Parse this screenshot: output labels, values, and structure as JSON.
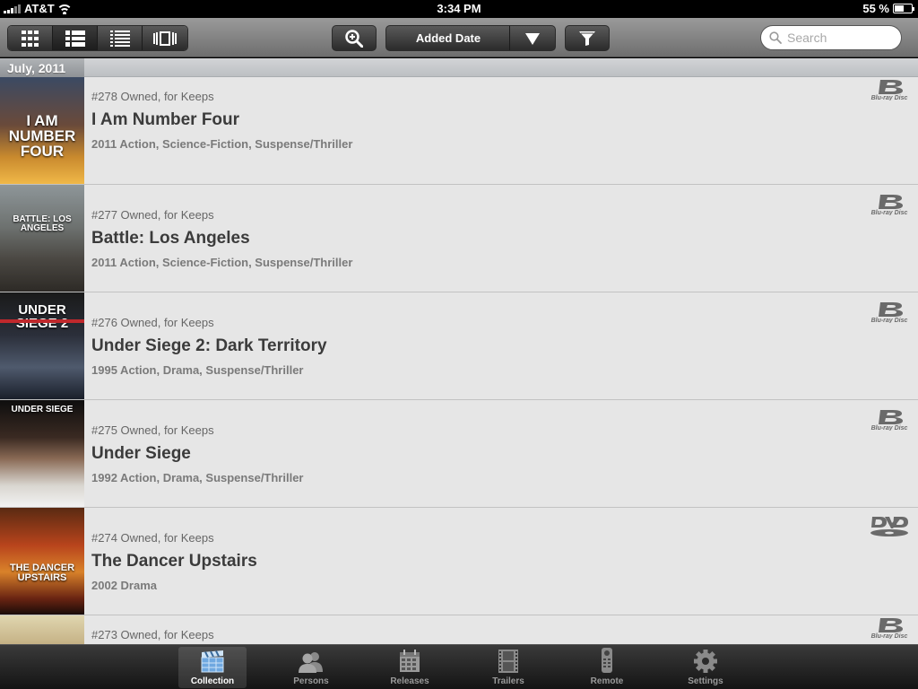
{
  "status": {
    "carrier": "AT&T",
    "time": "3:34 PM",
    "battery": "55 %",
    "battery_level": 0.55
  },
  "toolbar": {
    "view_modes": [
      {
        "name": "grid-large-view",
        "active": false
      },
      {
        "name": "list-detail-view",
        "active": true
      },
      {
        "name": "list-compact-view",
        "active": false
      },
      {
        "name": "cover-flow-view",
        "active": false
      }
    ],
    "sort_label": "Added Date",
    "search_placeholder": "Search"
  },
  "section": {
    "label": "July, 2011"
  },
  "movies": [
    {
      "number_status": "#278 Owned, for Keeps",
      "title": "I Am Number Four",
      "meta": "2011 Action, Science-Fiction, Suspense/Thriller",
      "format": "blu-ray",
      "cover_text": "I AM NUMBER FOUR"
    },
    {
      "number_status": "#277 Owned, for Keeps",
      "title": "Battle: Los Angeles",
      "meta": "2011 Action, Science-Fiction, Suspense/Thriller",
      "format": "blu-ray",
      "cover_text": "BATTLE: LOS ANGELES"
    },
    {
      "number_status": "#276 Owned, for Keeps",
      "title": "Under Siege 2: Dark Territory",
      "meta": "1995 Action, Drama, Suspense/Thriller",
      "format": "blu-ray",
      "cover_text": "UNDER SIEGE 2"
    },
    {
      "number_status": "#275 Owned, for Keeps",
      "title": "Under Siege",
      "meta": "1992 Action, Drama, Suspense/Thriller",
      "format": "blu-ray",
      "cover_text": "UNDER SIEGE"
    },
    {
      "number_status": "#274 Owned, for Keeps",
      "title": "The Dancer Upstairs",
      "meta": "2002 Drama",
      "format": "dvd",
      "cover_text": "THE DANCER UPSTAIRS"
    },
    {
      "number_status": "#273 Owned, for Keeps",
      "title": "",
      "meta": "",
      "format": "blu-ray",
      "cover_text": ""
    }
  ],
  "tabs": [
    {
      "label": "Collection",
      "icon": "clapperboard-icon",
      "active": true
    },
    {
      "label": "Persons",
      "icon": "persons-icon",
      "active": false
    },
    {
      "label": "Releases",
      "icon": "calendar-icon",
      "active": false
    },
    {
      "label": "Trailers",
      "icon": "film-strip-icon",
      "active": false
    },
    {
      "label": "Remote",
      "icon": "remote-icon",
      "active": false
    },
    {
      "label": "Settings",
      "icon": "gear-icon",
      "active": false
    }
  ],
  "colors": {
    "toolbar": "#7e7e7e",
    "row_background": "#e6e6e6",
    "title_text": "#3b3b3b",
    "meta_text": "#7a7a7a"
  }
}
